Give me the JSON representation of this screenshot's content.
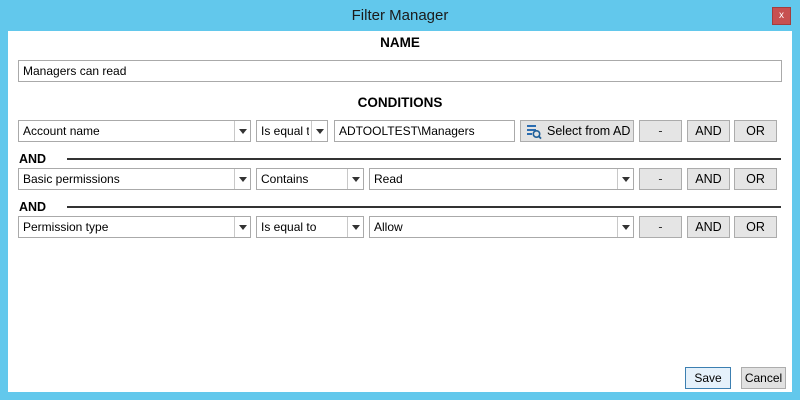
{
  "window": {
    "title": "Filter Manager",
    "close_glyph": "x"
  },
  "name_section": {
    "heading": "NAME",
    "value": "Managers can read"
  },
  "conditions_section": {
    "heading": "CONDITIONS",
    "rows": [
      {
        "field": "Account name",
        "operator": "Is equal t",
        "value": "ADTOOLTEST\\Managers",
        "select_label": "Select from AD",
        "remove_label": "-",
        "and_label": "AND",
        "or_label": "OR"
      },
      {
        "connector": "AND",
        "field": "Basic permissions",
        "operator": "Contains",
        "value": "Read",
        "remove_label": "-",
        "and_label": "AND",
        "or_label": "OR"
      },
      {
        "connector": "AND",
        "field": "Permission type",
        "operator": "Is equal to",
        "value": "Allow",
        "remove_label": "-",
        "and_label": "AND",
        "or_label": "OR"
      }
    ]
  },
  "footer": {
    "save_label": "Save",
    "cancel_label": "Cancel"
  },
  "colors": {
    "window_frame": "#62c8ec",
    "close_button": "#c75050",
    "button_bg": "#e5e5e5"
  },
  "icons": {
    "select_from_ad": "ad-search-icon",
    "close": "close-icon",
    "dropdown": "chevron-down-icon"
  }
}
